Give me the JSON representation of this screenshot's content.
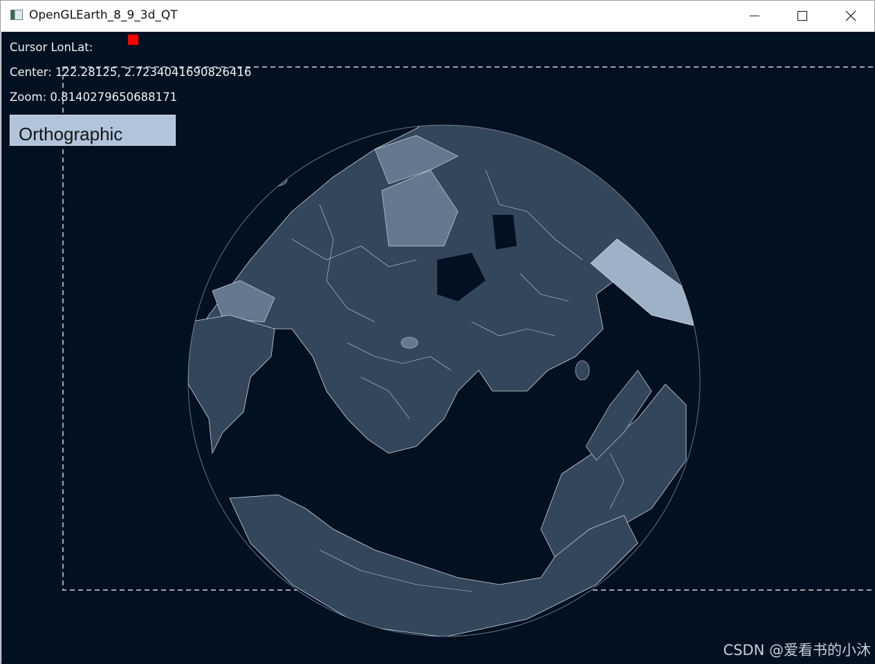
{
  "window": {
    "title": "OpenGLEarth_8_9_3d_QT",
    "app_icon": "app-window-icon",
    "controls": {
      "minimize": "minimize-icon",
      "maximize": "maximize-icon",
      "close": "close-icon"
    }
  },
  "hud": {
    "cursor_lonlat": "Cursor LonLat:",
    "center": "Center: 122.28125, 2.7234041690826416",
    "zoom": "Zoom: 0.8140279650688171"
  },
  "projection_button": {
    "label": "Orthographic"
  },
  "watermark": "CSDN @爱看书的小沐",
  "colors": {
    "background": "#021122",
    "land": "#34465a",
    "land_light": "#66788e",
    "borders": "#c9d6e3",
    "marker": "#ff0000",
    "button": "#b1c4dc"
  }
}
